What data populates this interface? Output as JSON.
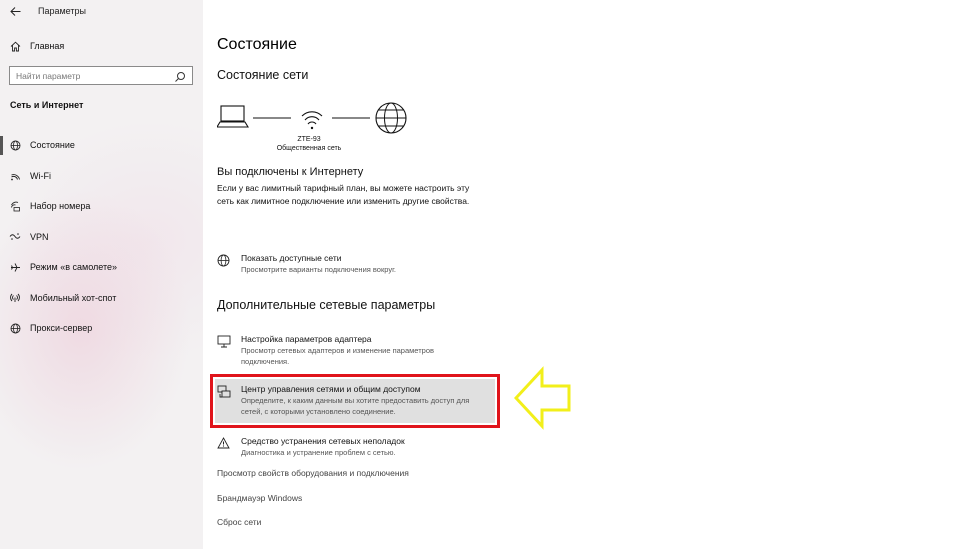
{
  "window": {
    "title": "Параметры"
  },
  "sidebar": {
    "home_label": "Главная",
    "search_placeholder": "Найти параметр",
    "section_title": "Сеть и Интернет",
    "items": [
      {
        "label": "Состояние",
        "icon": "globe-icon"
      },
      {
        "label": "Wi-Fi",
        "icon": "wifi-icon"
      },
      {
        "label": "Набор номера",
        "icon": "dialup-icon"
      },
      {
        "label": "VPN",
        "icon": "vpn-icon"
      },
      {
        "label": "Режим «в самолете»",
        "icon": "airplane-icon"
      },
      {
        "label": "Мобильный хот-спот",
        "icon": "hotspot-icon"
      },
      {
        "label": "Прокси-сервер",
        "icon": "globe-icon"
      }
    ],
    "active_index": 0
  },
  "main": {
    "page_title": "Состояние",
    "network_status_title": "Состояние сети",
    "diagram": {
      "ssid": "ZTE-93",
      "network_type": "Общественная сеть"
    },
    "connected_title": "Вы подключены к Интернету",
    "connected_desc": "Если у вас лимитный тарифный план, вы можете настроить эту сеть как лимитное подключение или изменить другие свойства.",
    "show_networks": {
      "title": "Показать доступные сети",
      "desc": "Просмотрите варианты подключения вокруг."
    },
    "advanced_title": "Дополнительные сетевые параметры",
    "adapter": {
      "title": "Настройка параметров адаптера",
      "desc_line1": "Просмотр сетевых адаптеров и изменение параметров",
      "desc_line2": "подключения."
    },
    "sharing_center": {
      "title": "Центр управления сетями и общим доступом",
      "desc_line1": "Определите, к каким данным вы хотите предоставить доступ для",
      "desc_line2": "сетей, с которыми установлено соединение."
    },
    "troubleshooter": {
      "title": "Средство устранения сетевых неполадок",
      "desc": "Диагностика и устранение проблем с сетью."
    },
    "links": [
      "Просмотр свойств оборудования и подключения",
      "Брандмауэр Windows",
      "Сброс сети"
    ]
  },
  "colors": {
    "highlight_border": "#e0141b",
    "arrow_stroke": "#f2ef1a",
    "sidebar_bg": "#f3f1f2"
  }
}
